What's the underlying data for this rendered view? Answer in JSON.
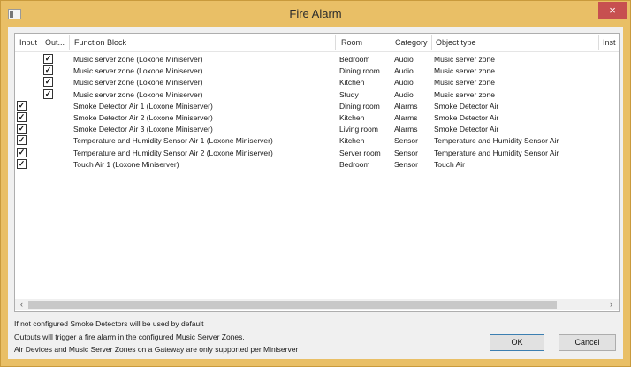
{
  "window": {
    "title": "Fire Alarm",
    "close_glyph": "×"
  },
  "table": {
    "columns": [
      "Input",
      "Out...",
      "Function Block",
      "Room",
      "Category",
      "Object type",
      "Inst"
    ],
    "rows": [
      {
        "input": false,
        "output": true,
        "function_block": "Music server zone (Loxone Miniserver)",
        "room": "Bedroom",
        "category": "Audio",
        "object_type": "Music server zone"
      },
      {
        "input": false,
        "output": true,
        "function_block": "Music server zone (Loxone Miniserver)",
        "room": "Dining room",
        "category": "Audio",
        "object_type": "Music server zone"
      },
      {
        "input": false,
        "output": true,
        "function_block": "Music server zone (Loxone Miniserver)",
        "room": "Kitchen",
        "category": "Audio",
        "object_type": "Music server zone"
      },
      {
        "input": false,
        "output": true,
        "function_block": "Music server zone (Loxone Miniserver)",
        "room": "Study",
        "category": "Audio",
        "object_type": "Music server zone"
      },
      {
        "input": true,
        "output": false,
        "function_block": "Smoke Detector Air 1 (Loxone Miniserver)",
        "room": "Dining room",
        "category": "Alarms",
        "object_type": "Smoke Detector Air"
      },
      {
        "input": true,
        "output": false,
        "function_block": "Smoke Detector Air 2 (Loxone Miniserver)",
        "room": "Kitchen",
        "category": "Alarms",
        "object_type": "Smoke Detector Air"
      },
      {
        "input": true,
        "output": false,
        "function_block": "Smoke Detector Air 3 (Loxone Miniserver)",
        "room": "Living room",
        "category": "Alarms",
        "object_type": "Smoke Detector Air"
      },
      {
        "input": true,
        "output": false,
        "function_block": "Temperature and Humidity Sensor Air 1 (Loxone Miniserver)",
        "room": "Kitchen",
        "category": "Sensor",
        "object_type": "Temperature and Humidity Sensor Air"
      },
      {
        "input": true,
        "output": false,
        "function_block": "Temperature and Humidity Sensor Air 2 (Loxone Miniserver)",
        "room": "Server room",
        "category": "Sensor",
        "object_type": "Temperature and Humidity Sensor Air"
      },
      {
        "input": true,
        "output": false,
        "function_block": "Touch Air 1 (Loxone Miniserver)",
        "room": "Bedroom",
        "category": "Sensor",
        "object_type": "Touch Air"
      }
    ],
    "check_glyph": "✓",
    "scroll_left_glyph": "‹",
    "scroll_right_glyph": "›"
  },
  "info_lines": [
    "If not configured Smoke Detectors will be used by default",
    "Outputs will trigger a fire alarm in the configured Music Server Zones.",
    "Air Devices and Music Server Zones on a Gateway are only supported per Miniserver"
  ],
  "buttons": {
    "ok": "OK",
    "cancel": "Cancel"
  }
}
